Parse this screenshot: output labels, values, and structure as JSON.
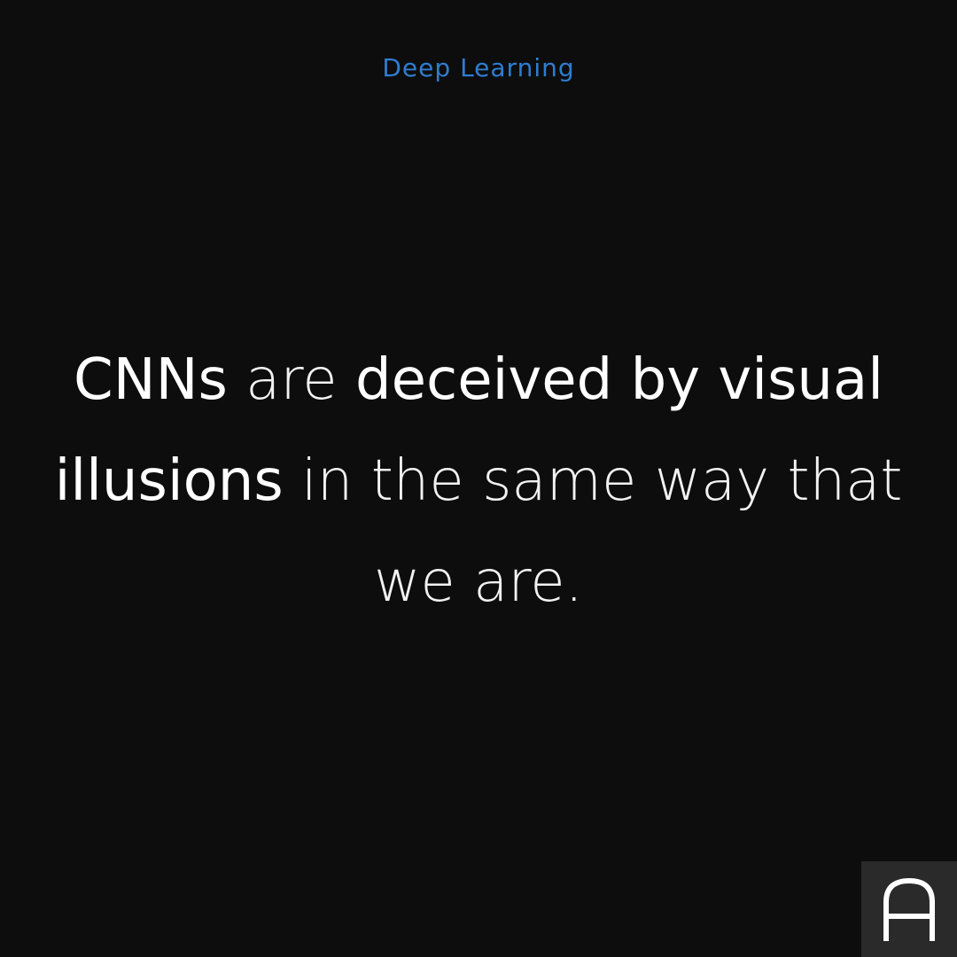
{
  "header": {
    "category": "Deep Learning"
  },
  "statement": {
    "segments": [
      {
        "text": "CNNs",
        "style": "bold"
      },
      {
        "text": " are ",
        "style": "light"
      },
      {
        "text": "deceived by visual illusions",
        "style": "bold"
      },
      {
        "text": " in the same way that we are.",
        "style": "light"
      }
    ]
  },
  "logo": {
    "icon": "letter-a-logo-icon",
    "text": "A"
  },
  "colors": {
    "background": "#0d0d0d",
    "accent": "#2e7dd1",
    "text": "#ffffff",
    "logo_bg": "#2a2a2a"
  }
}
